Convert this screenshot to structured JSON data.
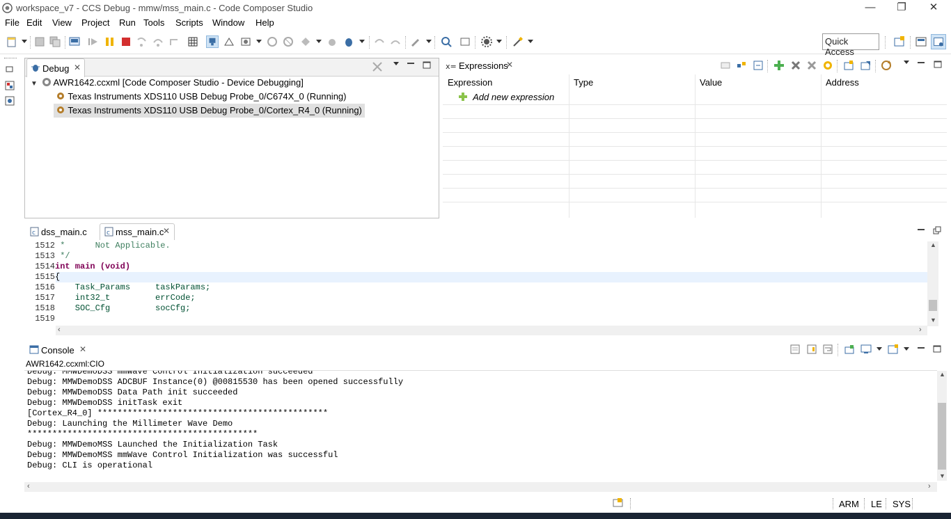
{
  "window": {
    "title": "workspace_v7 - CCS Debug - mmw/mss_main.c - Code Composer Studio",
    "minimize": "—",
    "restore": "❐",
    "close": "✕"
  },
  "menu": [
    "File",
    "Edit",
    "View",
    "Project",
    "Run",
    "Tools",
    "Scripts",
    "Window",
    "Help"
  ],
  "toolbar": {
    "quick_access": "Quick Access"
  },
  "debug_view": {
    "tab_label": "Debug",
    "root": "AWR1642.ccxml [Code Composer Studio - Device Debugging]",
    "children": [
      "Texas Instruments XDS110 USB Debug Probe_0/C674X_0 (Running)",
      "Texas Instruments XDS110 USB Debug Probe_0/Cortex_R4_0 (Running)"
    ]
  },
  "expressions_view": {
    "tab_label": "Expressions",
    "columns": [
      "Expression",
      "Type",
      "Value",
      "Address"
    ],
    "add_new": "Add new expression"
  },
  "editor": {
    "tabs": [
      "dss_main.c",
      "mss_main.c"
    ],
    "active_tab": "mss_main.c",
    "lines": [
      {
        "num": "1512",
        "text": " *      Not Applicable.",
        "kind": "comment"
      },
      {
        "num": "1513",
        "text": " */",
        "kind": "comment"
      },
      {
        "num": "1514",
        "text": "int main (void)",
        "kind": "signature"
      },
      {
        "num": "1515",
        "text": "{",
        "kind": "plain"
      },
      {
        "num": "1516",
        "text": "    Task_Params     taskParams;",
        "kind": "decl"
      },
      {
        "num": "1517",
        "text": "    int32_t         errCode;",
        "kind": "decl"
      },
      {
        "num": "1518",
        "text": "    SOC_Cfg         socCfg;",
        "kind": "decl"
      },
      {
        "num": "1519",
        "text": "",
        "kind": "plain"
      }
    ]
  },
  "console": {
    "tab_label": "Console",
    "subtitle": "AWR1642.ccxml:CIO",
    "lines": [
      "Debug: MMWDemoDSS mmWave Control Initialization succeeded",
      "Debug: MMWDemoDSS ADCBUF Instance(0) @00815530 has been opened successfully",
      "Debug: MMWDemoDSS Data Path init succeeded",
      "Debug: MMWDemoDSS initTask exit",
      "[Cortex_R4_0] **********************************************",
      "Debug: Launching the Millimeter Wave Demo",
      "**********************************************",
      "Debug: MMWDemoMSS Launched the Initialization Task",
      "Debug: MMWDemoMSS mmWave Control Initialization was successful",
      "Debug: CLI is operational"
    ]
  },
  "statusbar": {
    "items": [
      "ARM",
      "LE",
      "SYS"
    ]
  },
  "colors": {
    "keyword": "#7f0055",
    "comment": "#3f7f5f",
    "type_ident": "#005032",
    "selection": "#e0e0e0",
    "current_line": "#e8f2fe"
  }
}
